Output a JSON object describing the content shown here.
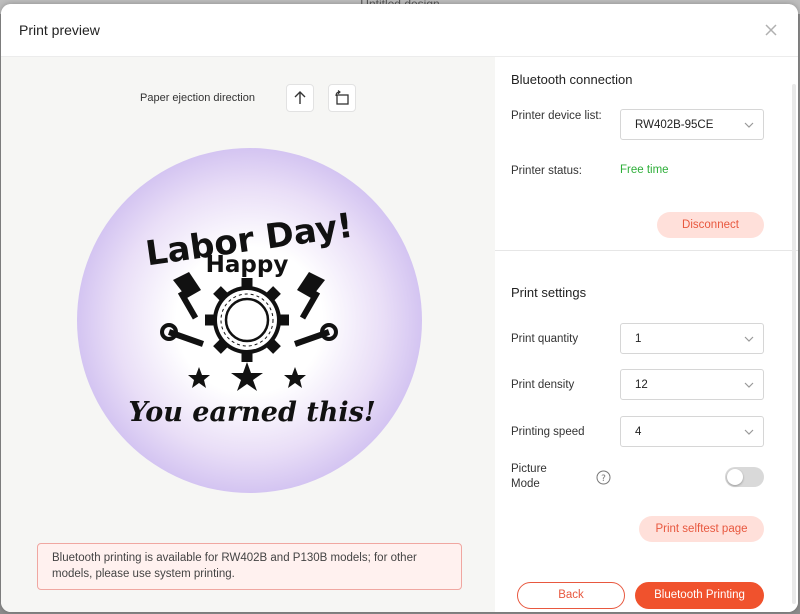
{
  "background": {
    "document_title": "Untitled design"
  },
  "dialog": {
    "title": "Print preview"
  },
  "preview": {
    "eject_label": "Paper ejection direction",
    "label_art": {
      "line1": "Labor Day!",
      "line2": "Happy",
      "line3": "You earned this!",
      "circle_color": "#bfaaec"
    },
    "info_note": "Bluetooth printing is available for RW402B and P130B models; for other models, please use system printing."
  },
  "bluetooth": {
    "section_title": "Bluetooth connection",
    "device_label": "Printer device list:",
    "device_value": "RW402B-95CE",
    "status_label": "Printer status:",
    "status_value": "Free time",
    "status_color": "#2dae38",
    "disconnect_label": "Disconnect"
  },
  "print_settings": {
    "section_title": "Print settings",
    "quantity_label": "Print quantity",
    "quantity_value": "1",
    "density_label": "Print density",
    "density_value": "12",
    "speed_label": "Printing speed",
    "speed_value": "4",
    "picture_mode_label": "Picture Mode",
    "picture_mode_on": false,
    "selftest_label": "Print selftest page"
  },
  "footer": {
    "back_label": "Back",
    "primary_label": "Bluetooth Printing",
    "accent_color": "#f0522d"
  }
}
